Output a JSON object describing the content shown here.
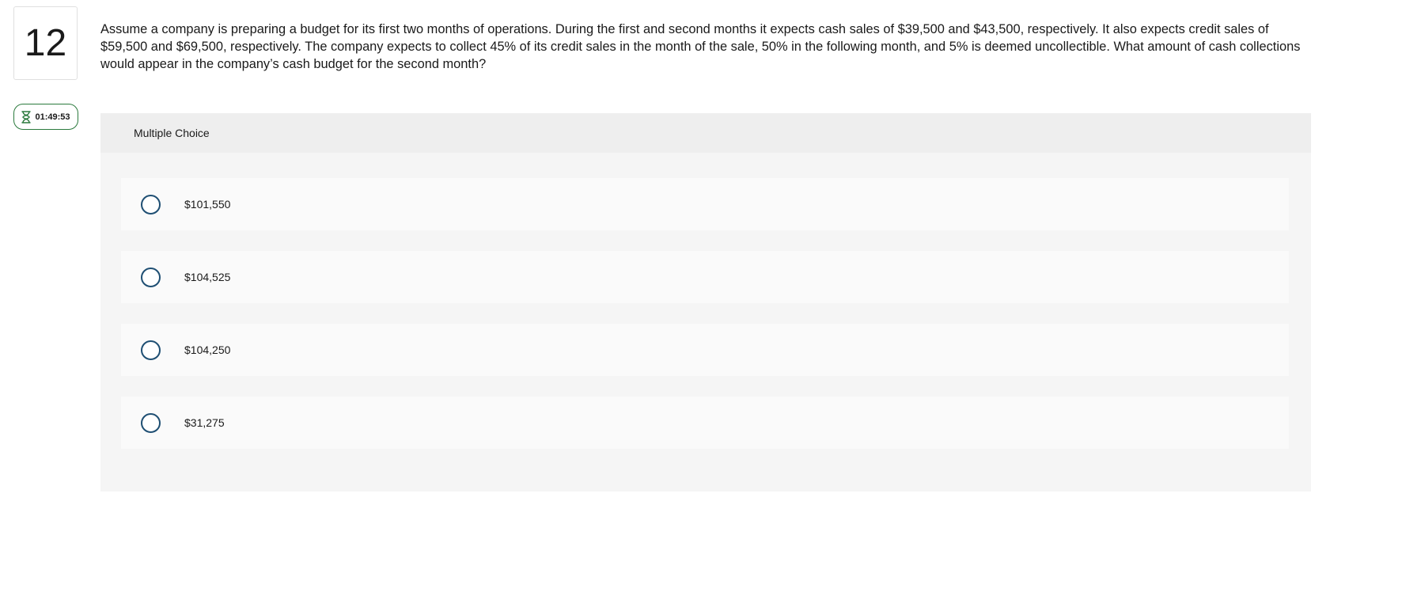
{
  "question": {
    "number": "12",
    "text": "Assume a company is preparing a budget for its first two months of operations. During the first and second months it expects cash sales of $39,500 and $43,500, respectively. It also expects credit sales of $59,500 and $69,500, respectively. The company expects to collect 45% of its credit sales in the month of the sale, 50% in the following month, and 5% is deemed uncollectible. What amount of cash collections would appear in the company’s cash budget for the second month?"
  },
  "timer": {
    "icon": "hourglass-icon",
    "value": "01:49:53",
    "color": "#2b7a3d"
  },
  "multiple_choice": {
    "header": "Multiple Choice",
    "options": [
      {
        "label": "$101,550"
      },
      {
        "label": "$104,525"
      },
      {
        "label": "$104,250"
      },
      {
        "label": "$31,275"
      }
    ]
  },
  "colors": {
    "radio_border": "#1f4f73",
    "panel_bg": "#f5f5f5",
    "header_bg": "#eeeeee"
  }
}
